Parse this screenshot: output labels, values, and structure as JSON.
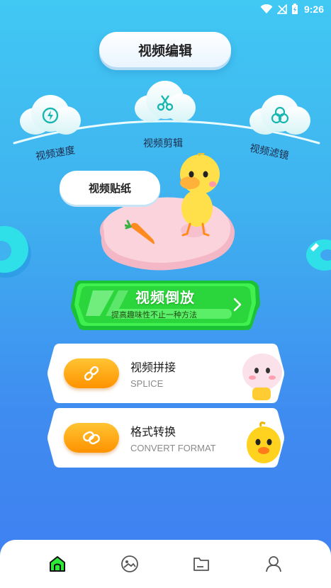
{
  "status_bar": {
    "time": "9:26"
  },
  "header": {
    "title": "视频编辑"
  },
  "features": [
    {
      "label": "视频速度",
      "icon": "speed-icon"
    },
    {
      "label": "视频剪辑",
      "icon": "scissors-icon"
    },
    {
      "label": "视频滤镜",
      "icon": "filter-icon"
    }
  ],
  "sticker": {
    "label": "视频贴纸"
  },
  "reverse": {
    "title": "视频倒放",
    "subtitle": "提高趣味性不止一种方法",
    "icon": "chevron-right-icon"
  },
  "cards": [
    {
      "title": "视频拼接",
      "subtitle": "SPLICE",
      "icon": "link-icon"
    },
    {
      "title": "格式转换",
      "subtitle": "CONVERT FORMAT",
      "icon": "convert-icon"
    }
  ],
  "nav": [
    {
      "name": "home",
      "icon": "home-icon"
    },
    {
      "name": "gallery",
      "icon": "image-icon"
    },
    {
      "name": "folder",
      "icon": "folder-icon"
    },
    {
      "name": "profile",
      "icon": "user-icon"
    }
  ],
  "colors": {
    "accent_green": "#2ee83a",
    "accent_orange": "#ff9a00",
    "bg_top": "#41c8f3",
    "bg_bottom": "#3f7ef1"
  }
}
